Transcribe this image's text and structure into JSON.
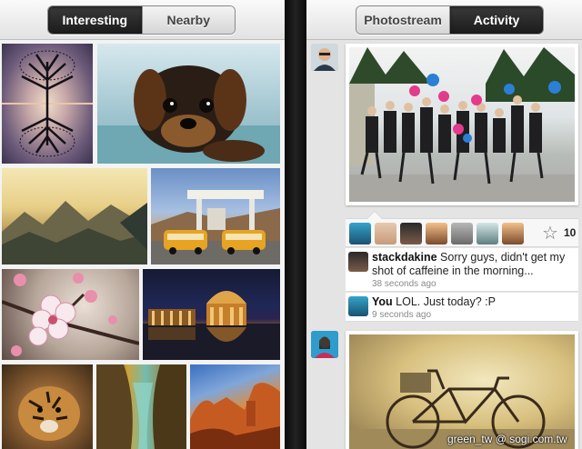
{
  "left_screen": {
    "tabs": [
      {
        "label": "Interesting",
        "selected": true
      },
      {
        "label": "Nearby",
        "selected": false
      }
    ],
    "photos": [
      {
        "icon": "tree-reflection-photo"
      },
      {
        "icon": "puppy-photo"
      },
      {
        "icon": "mountain-landscape-photo"
      },
      {
        "icon": "gas-station-vans-photo"
      },
      {
        "icon": "cherry-blossom-photo"
      },
      {
        "icon": "palace-at-night-photo"
      },
      {
        "icon": "tiger-photo"
      },
      {
        "icon": "cave-photo"
      },
      {
        "icon": "canyon-photo"
      }
    ]
  },
  "right_screen": {
    "tabs": [
      {
        "label": "Photostream",
        "selected": false
      },
      {
        "label": "Activity",
        "selected": true
      }
    ],
    "favorites": {
      "count": "10"
    },
    "comments": [
      {
        "author": "stackdakine",
        "text": " Sorry guys, didn't get my shot of caffeine in the morning...",
        "time": "38 seconds ago"
      },
      {
        "author": "You",
        "text": " LOL. Just today? :P",
        "time": "9 seconds ago"
      }
    ]
  },
  "watermark": "green_tw  @ sogi.com.tw"
}
